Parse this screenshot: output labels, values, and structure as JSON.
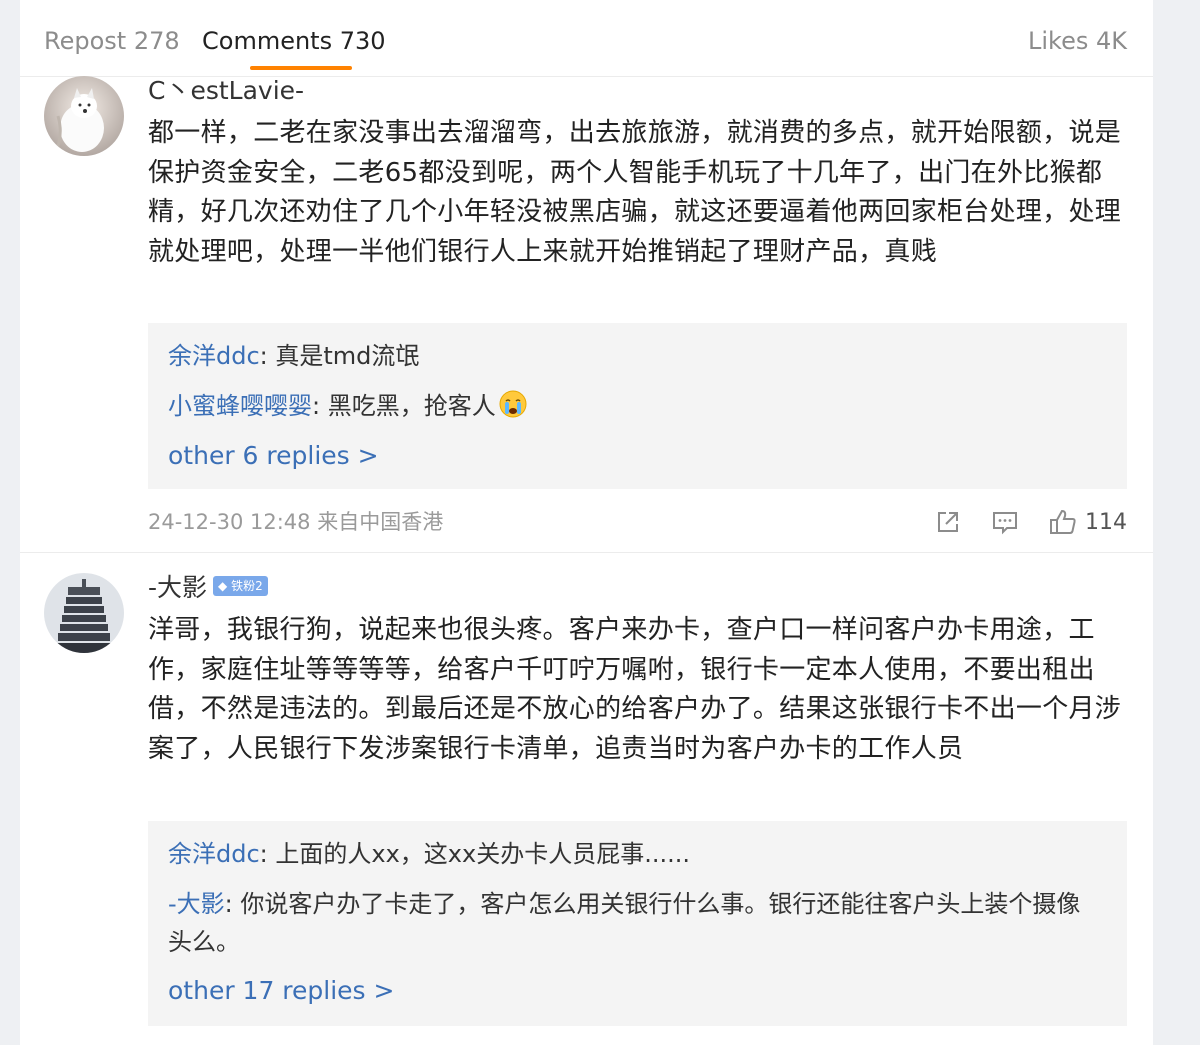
{
  "tabs": {
    "repost": "Repost 278",
    "comments": "Comments 730",
    "likes": "Likes 4K"
  },
  "comments": [
    {
      "user": "C丶estLavie-",
      "text": "都一样，二老在家没事出去溜溜弯，出去旅旅游，就消费的多点，就开始限额，说是保护资金安全，二老65都没到呢，两个人智能手机玩了十几年了，出门在外比猴都精，好几次还劝住了几个小年轻没被黑店骗，就这还要逼着他两回家柜台处理，处理就处理吧，处理一半他们银行人上来就开始推销起了理财产品，真贱",
      "replies": [
        {
          "user": "余洋ddc",
          "text": ": 真是tmd流氓"
        },
        {
          "user": "小蜜蜂嘤嘤婴",
          "text": ": 黑吃黑，抢客人"
        }
      ],
      "more": "other 6 replies >",
      "meta": "24-12-30 12:48  来自中国香港",
      "likes": "114"
    },
    {
      "user": "-大影",
      "badge": "铁粉2",
      "text": "洋哥，我银行狗，说起来也很头疼。客户来办卡，查户口一样问客户办卡用途，工作，家庭住址等等等等，给客户千叮咛万嘱咐，银行卡一定本人使用，不要出租出借，不然是违法的。到最后还是不放心的给客户办了。结果这张银行卡不出一个月涉案了，人民银行下发涉案银行卡清单，追责当时为客户办卡的工作人员",
      "replies": [
        {
          "user": "余洋ddc",
          "text": ": 上面的人xx，这xx关办卡人员屁事......"
        },
        {
          "user": "-大影",
          "text": ": 你说客户办了卡走了，客户怎么用关银行什么事。银行还能往客户头上装个摄像头么。"
        }
      ],
      "more": "other 17 replies >"
    }
  ],
  "icons": {
    "share": "share-icon",
    "comment": "comment-icon",
    "like": "thumbs-up-icon",
    "crying_emoji": "crying-emoji-icon"
  },
  "colors": {
    "accent": "#ff8200",
    "link": "#3b6fb6",
    "badge": "#7aa8ea"
  }
}
